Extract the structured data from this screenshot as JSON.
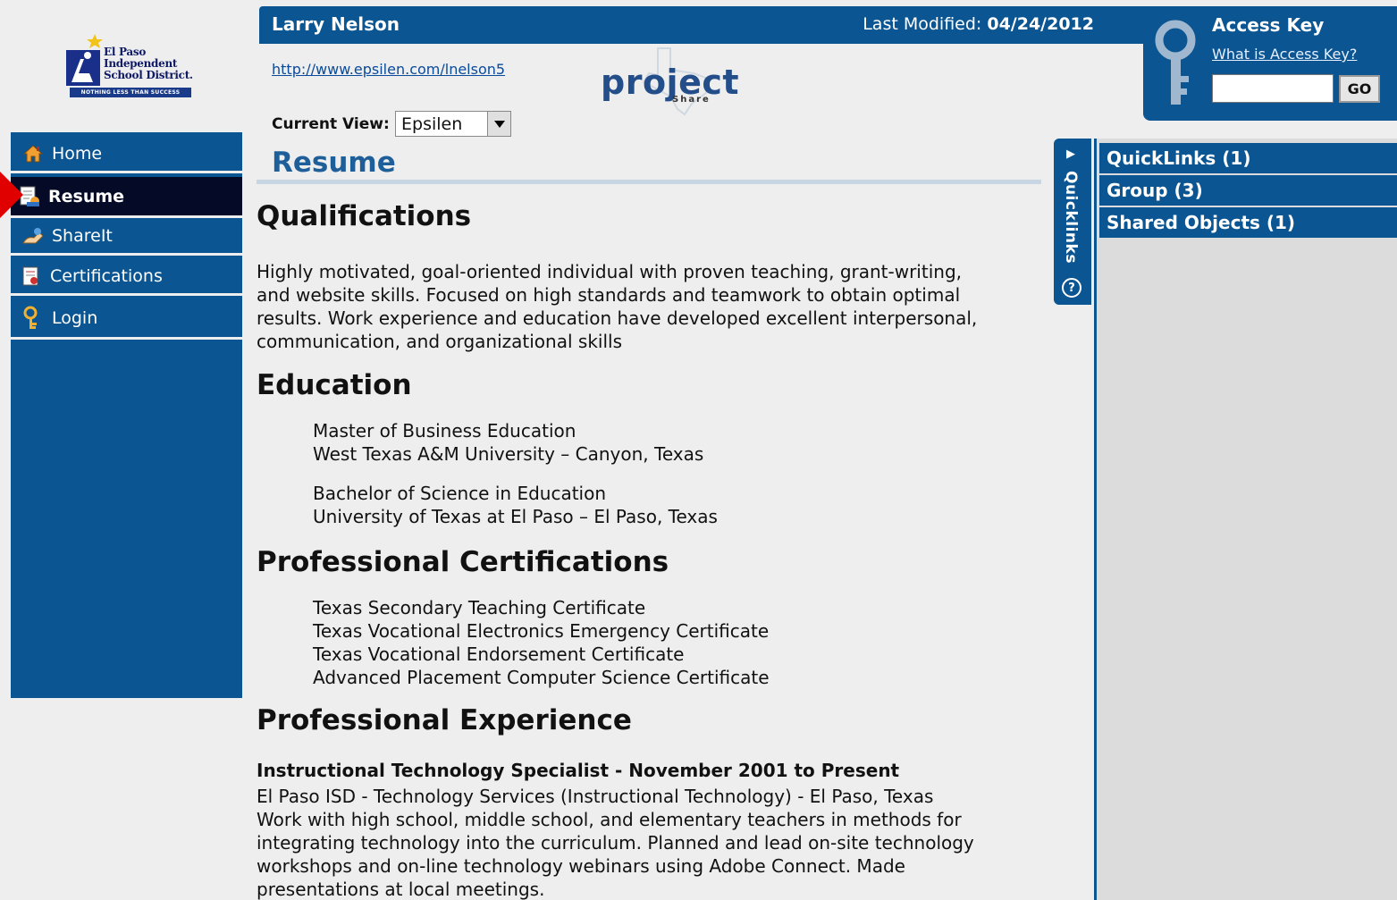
{
  "logo": {
    "line1": "El Paso",
    "line2": "Independent",
    "line3": "School District.",
    "tagline": "NOTHING LESS THAN SUCCESS"
  },
  "sidebar": {
    "items": [
      {
        "label": "Home",
        "icon": "home-icon"
      },
      {
        "label": "Resume",
        "icon": "resume-icon",
        "active": true
      },
      {
        "label": "ShareIt",
        "icon": "share-icon"
      },
      {
        "label": "Certifications",
        "icon": "certificate-icon"
      },
      {
        "label": "Login",
        "icon": "key-icon"
      }
    ]
  },
  "header": {
    "name": "Larry Nelson",
    "last_modified_label": "Last Modified:",
    "last_modified_value": "04/24/2012"
  },
  "access_key": {
    "title": "Access Key",
    "help_link": "What is Access Key?",
    "input_value": "",
    "go_label": "GO"
  },
  "profile_url": "http://www.epsilen.com/lnelson5",
  "project_share": {
    "text": "project",
    "subtext": "Share"
  },
  "current_view": {
    "label": "Current View:",
    "value": "Epsilen"
  },
  "page_title": "Resume",
  "resume": {
    "qualifications": {
      "heading": "Qualifications",
      "lines": [
        "Highly motivated, goal-oriented individual with proven teaching, grant-writing,",
        "and website skills.  Focused on high standards and teamwork to obtain optimal",
        "results.  Work experience and education have developed excellent interpersonal,",
        "communication, and organizational skills"
      ]
    },
    "education": {
      "heading": "Education",
      "entries": [
        {
          "degree": "Master of Business Education",
          "school": "West Texas A&M University – Canyon, Texas"
        },
        {
          "degree": "Bachelor of Science in Education",
          "school": "University of Texas at El Paso – El Paso, Texas"
        }
      ]
    },
    "certifications": {
      "heading": "Professional Certifications",
      "items": [
        "Texas Secondary Teaching Certificate",
        "Texas Vocational Electronics Emergency Certificate",
        "Texas Vocational Endorsement Certificate",
        "Advanced Placement Computer Science Certificate"
      ]
    },
    "experience": {
      "heading": "Professional Experience",
      "job_title": "Instructional Technology Specialist - November 2001 to Present",
      "lines": [
        "El Paso ISD - Technology Services (Instructional Technology) - El Paso, Texas",
        "Work with high school, middle school, and elementary teachers in methods for",
        "integrating technology into the curriculum. Planned and lead on-site technology",
        "workshops and on-line technology webinars using Adobe Connect.  Made",
        "presentations at local meetings."
      ]
    }
  },
  "quicklinks_tab": {
    "label": "Quicklinks",
    "help": "?"
  },
  "right_panel": {
    "items": [
      {
        "label": "QuickLinks (1)"
      },
      {
        "label": "Group (3)"
      },
      {
        "label": "Shared Objects (1)"
      }
    ]
  },
  "colors": {
    "primary_blue": "#0a5592",
    "active_nav": "#050a26",
    "heading_blue": "#1f5f99",
    "indicator_red": "#e00000"
  }
}
